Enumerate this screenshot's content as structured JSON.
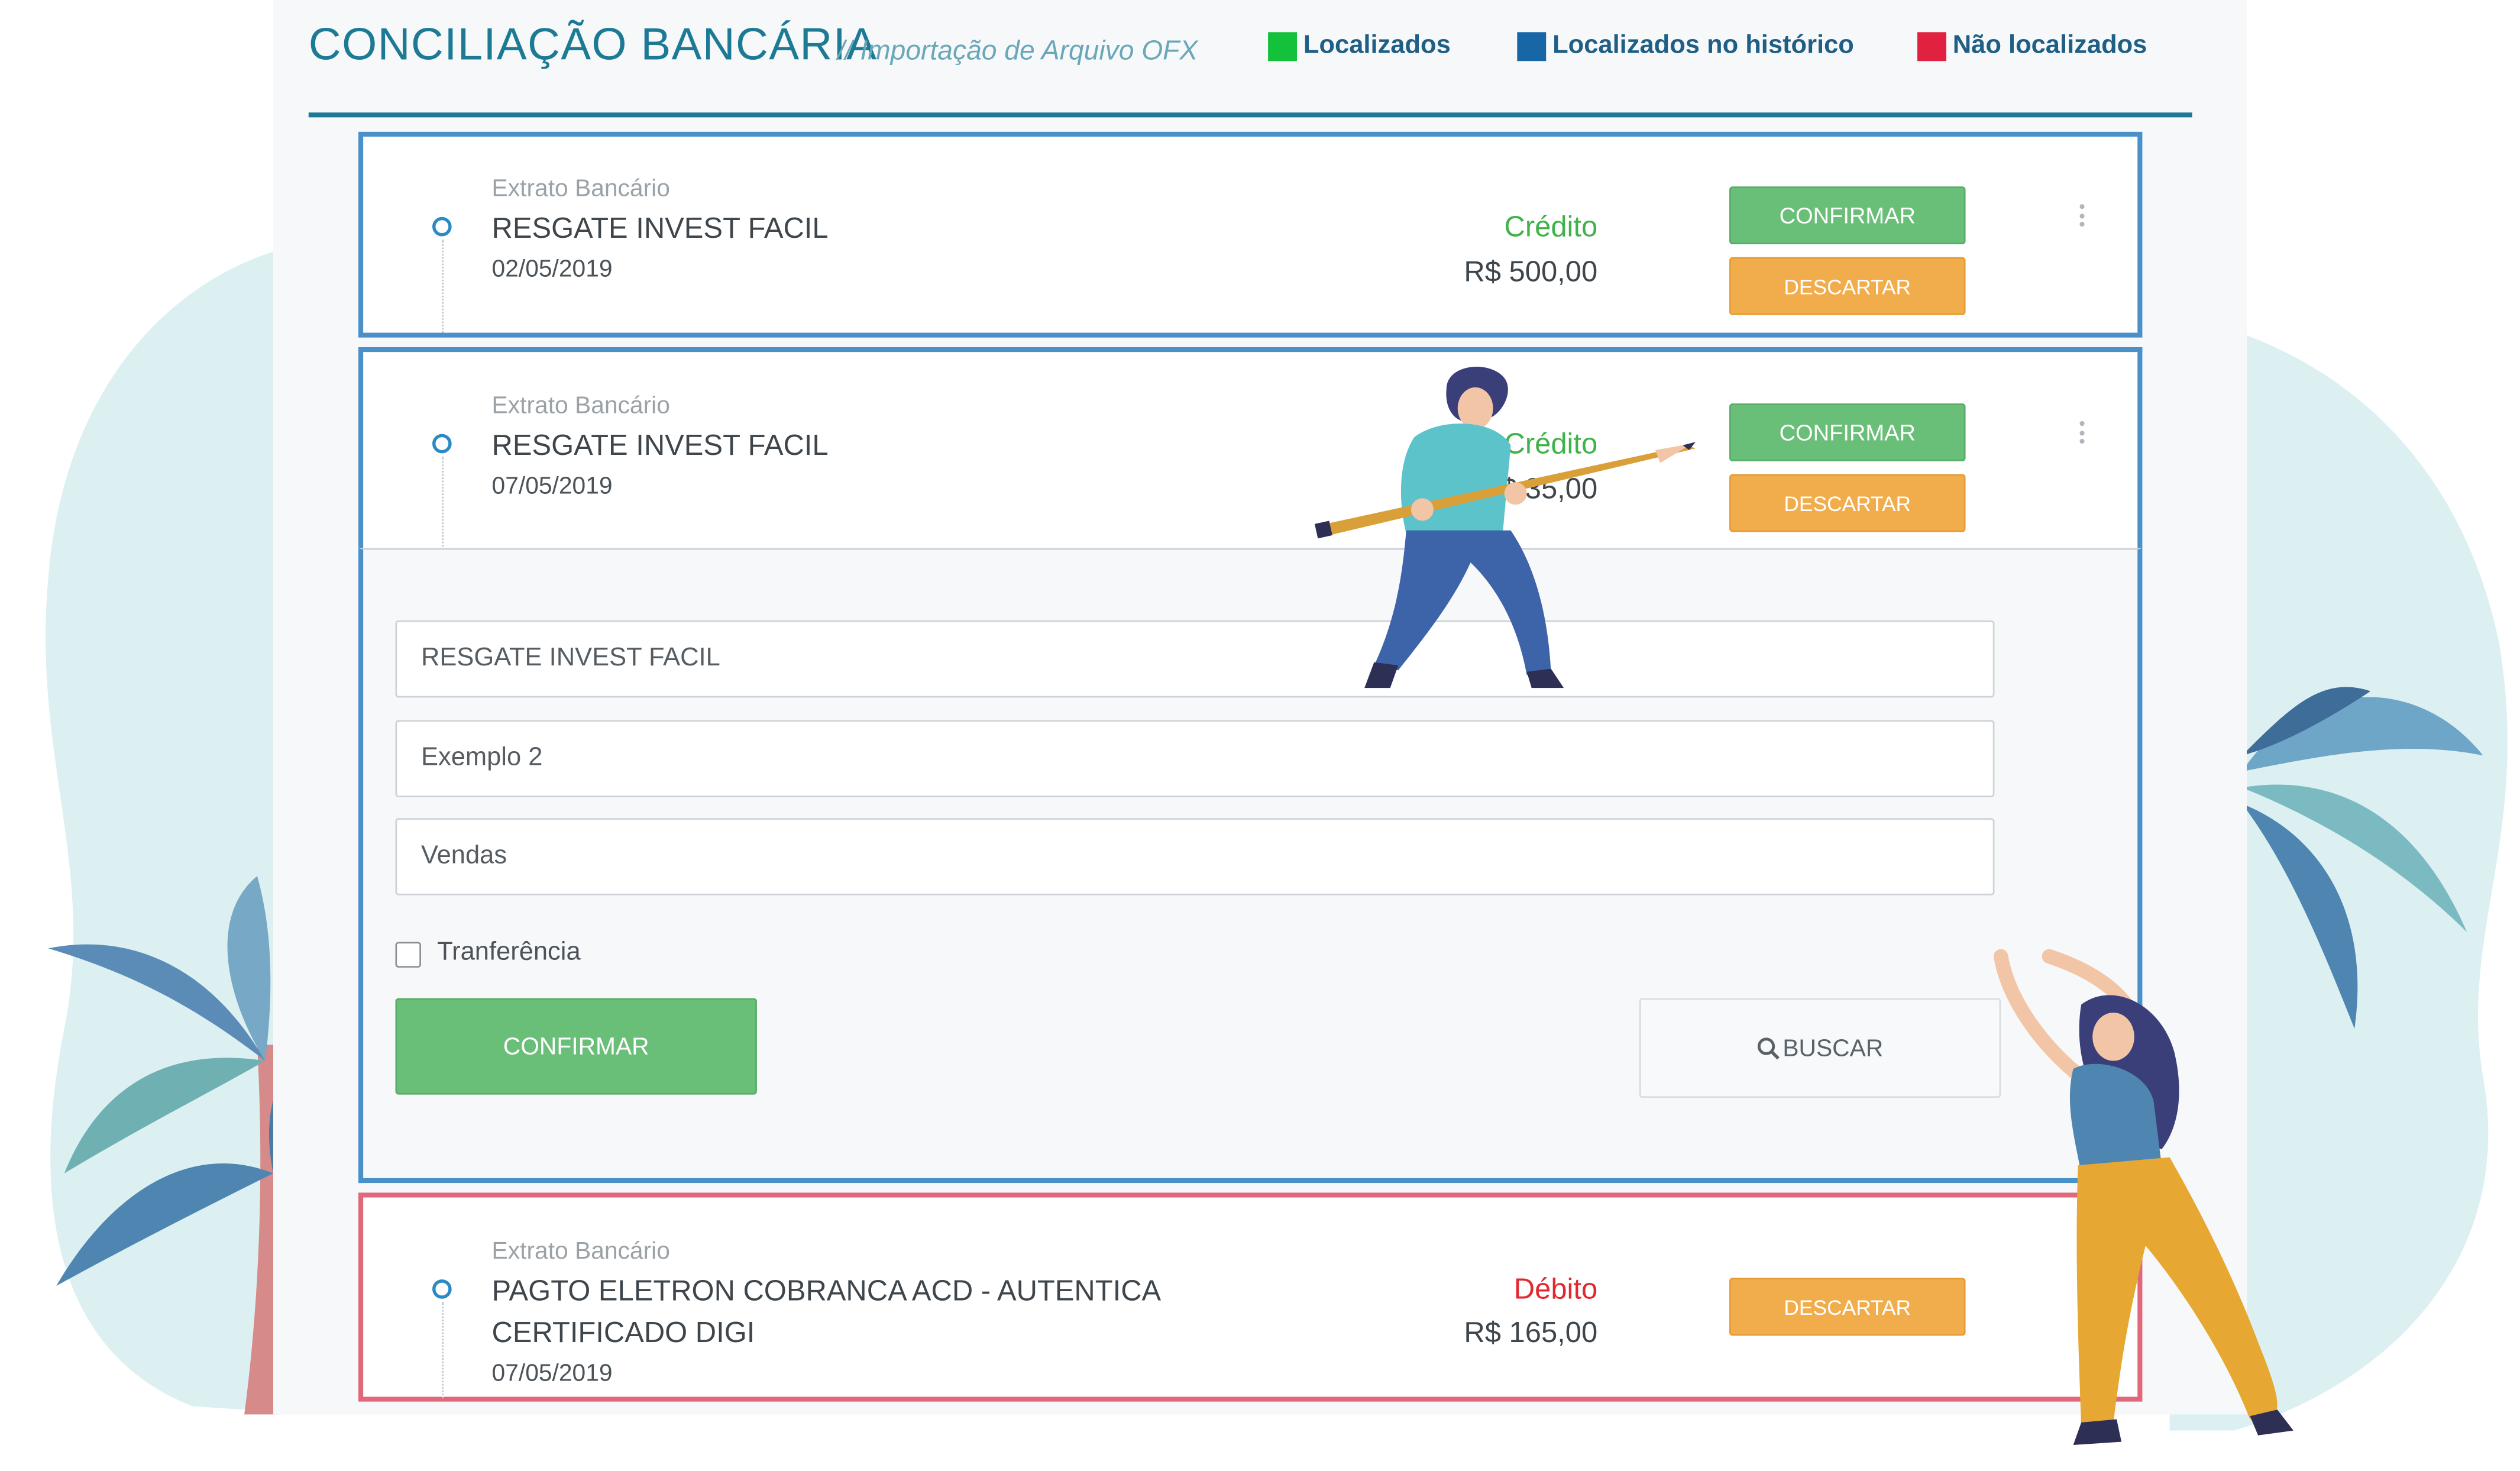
{
  "header": {
    "title": "CONCILIAÇÃO BANCÁRIA",
    "subtitle": "// Importação de Arquivo OFX",
    "legend": [
      {
        "label": "Localizados",
        "color": "#13c13b"
      },
      {
        "label": "Localizados no histórico",
        "color": "#1766a6"
      },
      {
        "label": "Não localizados",
        "color": "#e0213f"
      }
    ]
  },
  "transactions": [
    {
      "source": "Extrato Bancário",
      "description": "RESGATE INVEST FACIL",
      "date": "02/05/2019",
      "type": "Crédito",
      "type_color": "#41b24a",
      "amount": "R$ 500,00",
      "confirm_label": "CONFIRMAR",
      "discard_label": "DESCARTAR"
    },
    {
      "source": "Extrato Bancário",
      "description": "RESGATE INVEST FACIL",
      "date": "07/05/2019",
      "type": "Crédito",
      "type_color": "#41b24a",
      "amount": "R$ 35,00",
      "confirm_label": "CONFIRMAR",
      "discard_label": "DESCARTAR"
    },
    {
      "source": "Extrato Bancário",
      "description_line1": "PAGTO ELETRON COBRANCA ACD - AUTENTICA",
      "description_line2": "CERTIFICADO DIGI",
      "date": "07/05/2019",
      "type": "Débito",
      "type_color": "#e2272f",
      "amount": "R$ 165,00",
      "discard_label": "DESCARTAR"
    }
  ],
  "form": {
    "field1_value": "RESGATE INVEST FACIL",
    "field2_value": "Exemplo 2",
    "field3_value": "Vendas",
    "checkbox_label": "Tranferência",
    "checkbox_checked": false,
    "confirm_label": "CONFIRMAR",
    "search_label": "BUSCAR",
    "search_icon": "search-icon"
  },
  "colors": {
    "accent": "#1d7a95",
    "card_border_blue": "#4a90c9",
    "card_border_red": "#e0687a",
    "confirm_green": "#6abf78",
    "discard_orange": "#f1ad4c"
  }
}
